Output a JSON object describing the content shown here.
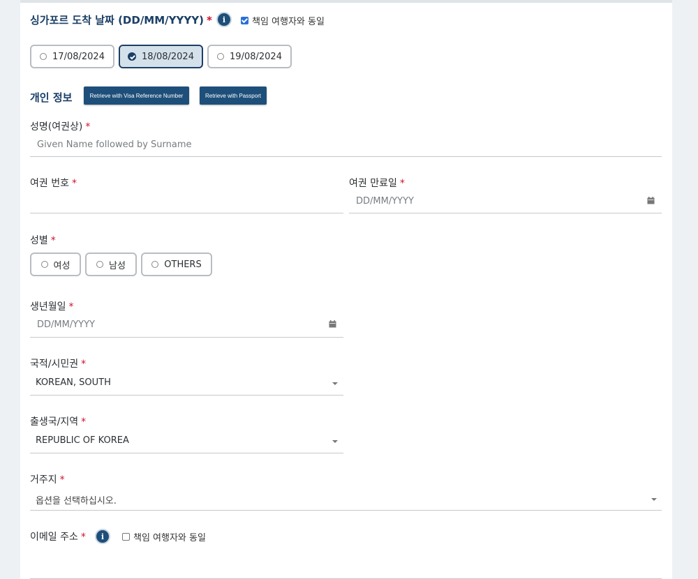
{
  "arrival": {
    "label": "싱가포르 도착 날짜 (DD/MM/YYYY)",
    "required_mark": "*",
    "info_icon": "info-icon",
    "same_as_traveler_label": "책임 여행자와 동일",
    "same_as_traveler_checked": true,
    "dates": [
      {
        "label": "17/08/2024",
        "selected": false
      },
      {
        "label": "18/08/2024",
        "selected": true
      },
      {
        "label": "19/08/2024",
        "selected": false
      }
    ]
  },
  "personal": {
    "title": "개인 정보",
    "retrieve_visa_label": "Retrieve with Visa Reference Number",
    "retrieve_passport_label": "Retrieve with Passport"
  },
  "fields": {
    "name": {
      "label": "성명(여권상)",
      "placeholder": "Given Name followed by Surname"
    },
    "passport_no": {
      "label": "여권 번호",
      "value": ""
    },
    "passport_expiry": {
      "label": "여권 만료일",
      "placeholder": "DD/MM/YYYY"
    },
    "gender": {
      "label": "성별",
      "options": [
        {
          "label": "여성",
          "selected": false
        },
        {
          "label": "남성",
          "selected": false
        },
        {
          "label": "OTHERS",
          "selected": false
        }
      ]
    },
    "dob": {
      "label": "생년월일",
      "placeholder": "DD/MM/YYYY"
    },
    "nationality": {
      "label": "국적/시민권",
      "value": "KOREAN, SOUTH"
    },
    "birth_country": {
      "label": "출생국/지역",
      "value": "REPUBLIC OF KOREA"
    },
    "residence": {
      "label": "거주지",
      "placeholder": "옵션을 선택하십시오."
    },
    "email": {
      "label": "이메일 주소",
      "same_as_traveler_label": "책임 여행자와 동일",
      "same_as_traveler_checked": false
    }
  },
  "colors": {
    "primary": "#1e4f7a",
    "required": "#d0102b",
    "heading": "#1b3f66"
  }
}
